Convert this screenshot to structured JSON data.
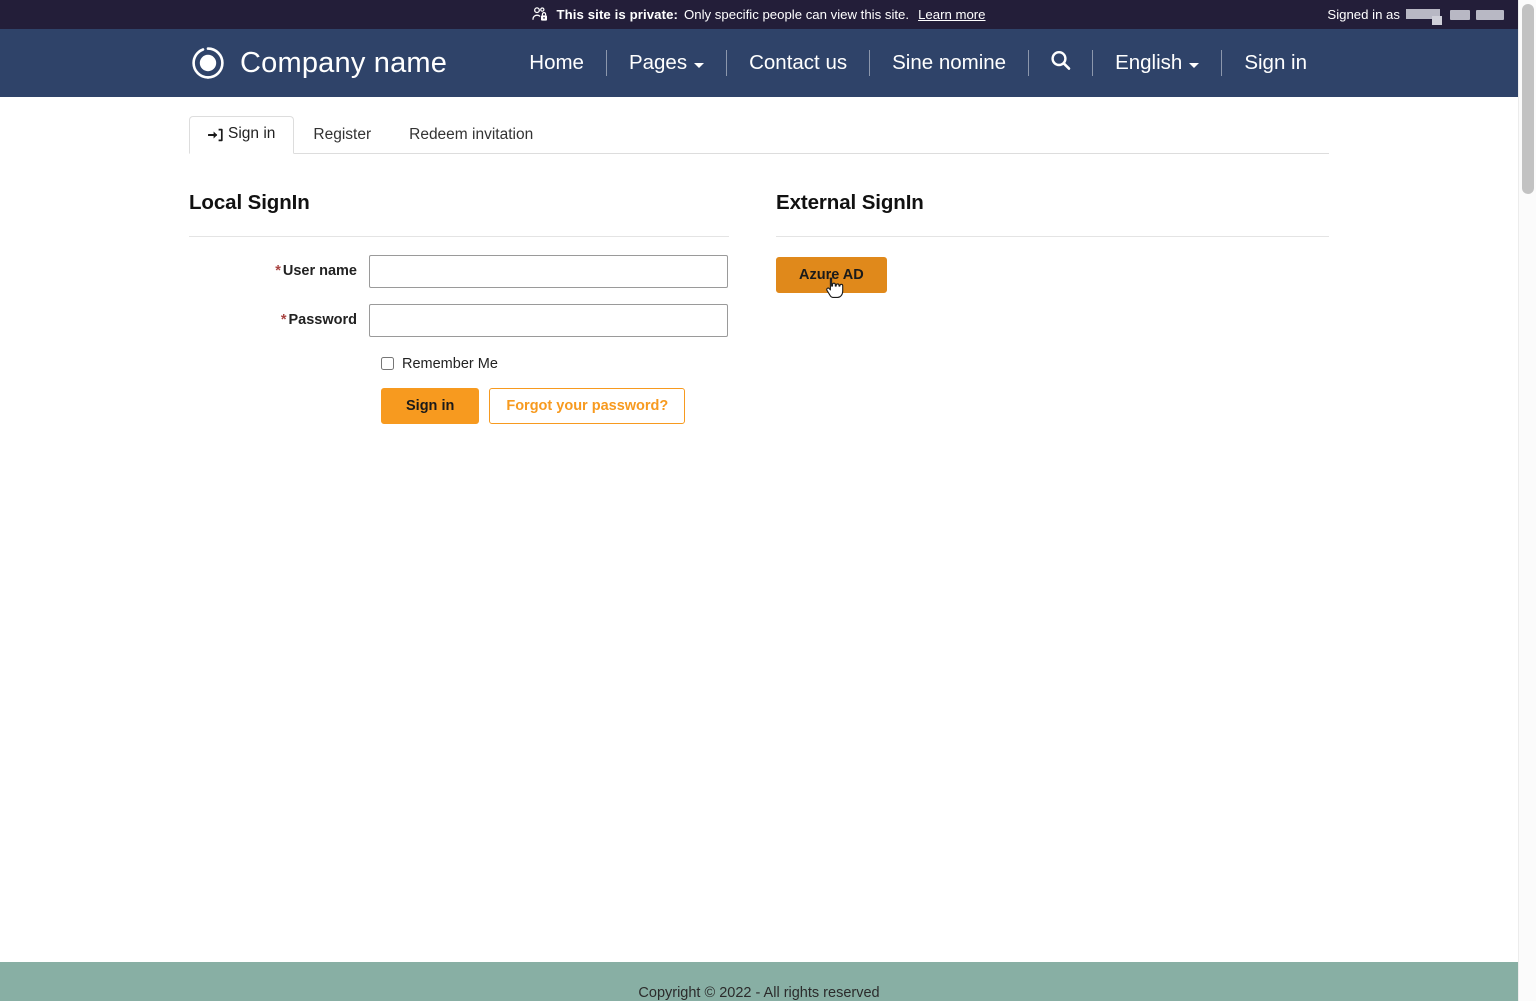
{
  "private_banner": {
    "icon": "people-lock-icon",
    "strong_text": "This site is private:",
    "message": "Only specific people can view this site.",
    "learn_more": "Learn more",
    "signed_in_prefix": "Signed in as",
    "signed_in_value_redacted": true
  },
  "navbar": {
    "logo_icon": "circle-target-logo-icon",
    "brand": "Company name",
    "items": [
      {
        "label": "Home",
        "has_caret": false
      },
      {
        "label": "Pages",
        "has_caret": true
      },
      {
        "label": "Contact us",
        "has_caret": false
      },
      {
        "label": "Sine nomine",
        "has_caret": false
      }
    ],
    "search_icon": "search-icon",
    "language": {
      "label": "English",
      "has_caret": true
    },
    "signin": "Sign in"
  },
  "tabs": [
    {
      "label": "Sign in",
      "icon": "sign-in-arrow-icon",
      "active": true
    },
    {
      "label": "Register",
      "icon": "",
      "active": false
    },
    {
      "label": "Redeem invitation",
      "icon": "",
      "active": false
    }
  ],
  "local_signin": {
    "title": "Local SignIn",
    "username": {
      "label": "User name",
      "required_marker": "*",
      "value": "",
      "placeholder": ""
    },
    "password": {
      "label": "Password",
      "required_marker": "*",
      "value": "",
      "placeholder": ""
    },
    "remember_me": {
      "label": "Remember Me",
      "checked": false
    },
    "submit_label": "Sign in",
    "forgot_label": "Forgot your password?"
  },
  "external_signin": {
    "title": "External SignIn",
    "providers": [
      {
        "label": "Azure AD",
        "hovered": true
      }
    ]
  },
  "footer": {
    "copyright": "Copyright © 2022 - All rights reserved"
  },
  "colors": {
    "banner_bg": "#231e39",
    "navbar_bg": "#2f4369",
    "accent_orange": "#f79a1f",
    "accent_orange_hover": "#e0891b",
    "footer_bg": "#88afa4",
    "required_red": "#a94442"
  }
}
